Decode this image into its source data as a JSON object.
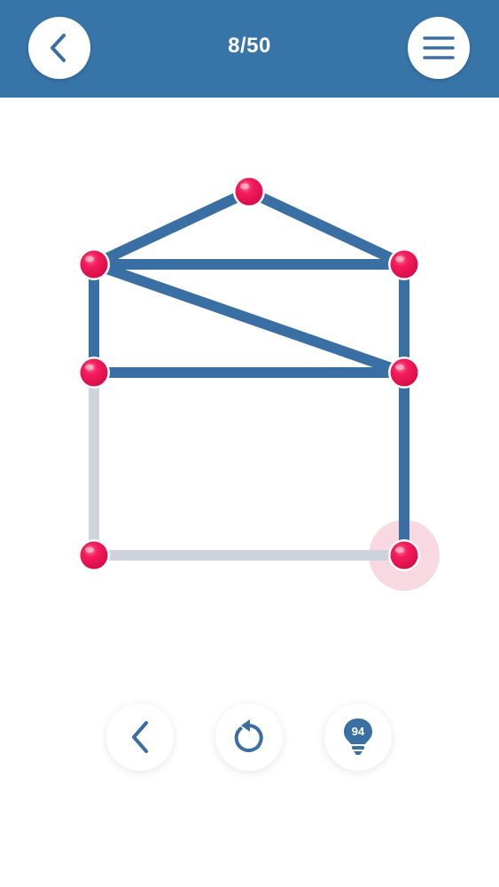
{
  "header": {
    "level_label": "8/50",
    "back_icon": "chevron-left-icon",
    "menu_icon": "hamburger-menu-icon"
  },
  "colors": {
    "header_bg": "#3774a8",
    "drawn_line": "#3a6fa3",
    "undrawn_line": "#cfd4dc",
    "dot": "#ef1357",
    "highlight": "#f7d2dd",
    "icon": "#3a6fa3"
  },
  "toolbar": {
    "undo_icon": "chevron-left-icon",
    "restart_icon": "restart-icon",
    "hint_icon": "lightbulb-icon",
    "hint_count": "94"
  },
  "puzzle": {
    "nodes": [
      {
        "id": "top"
      },
      {
        "id": "upper-left"
      },
      {
        "id": "upper-right"
      },
      {
        "id": "middle-left"
      },
      {
        "id": "middle-right"
      },
      {
        "id": "bottom-left"
      },
      {
        "id": "bottom-right",
        "current": true
      }
    ],
    "edges": [
      {
        "from": "upper-left",
        "to": "top",
        "drawn": true
      },
      {
        "from": "top",
        "to": "upper-right",
        "drawn": true
      },
      {
        "from": "upper-left",
        "to": "upper-right",
        "drawn": true
      },
      {
        "from": "upper-left",
        "to": "middle-right",
        "drawn": true
      },
      {
        "from": "upper-left",
        "to": "middle-left",
        "drawn": true
      },
      {
        "from": "upper-right",
        "to": "middle-right",
        "drawn": true
      },
      {
        "from": "middle-left",
        "to": "middle-right",
        "drawn": true
      },
      {
        "from": "middle-right",
        "to": "bottom-right",
        "drawn": true
      },
      {
        "from": "middle-left",
        "to": "bottom-left",
        "drawn": false
      },
      {
        "from": "bottom-left",
        "to": "bottom-right",
        "drawn": false
      }
    ]
  }
}
